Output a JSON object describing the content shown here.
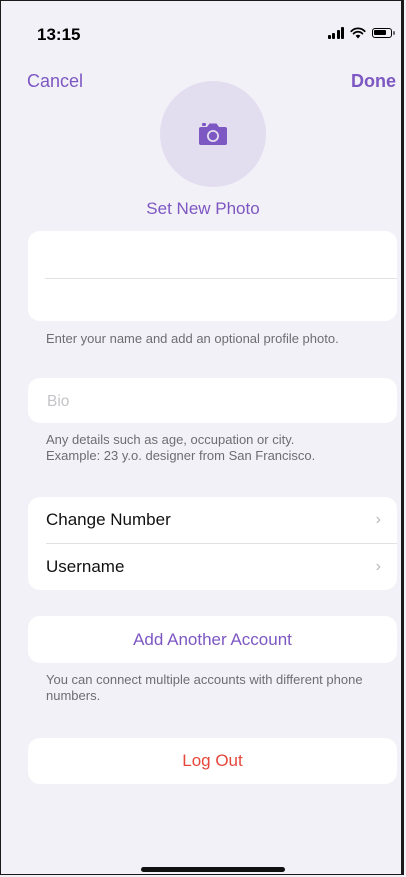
{
  "status_bar": {
    "time": "13:15"
  },
  "nav": {
    "cancel_label": "Cancel",
    "done_label": "Done"
  },
  "profile": {
    "set_photo_label": "Set New Photo"
  },
  "name": {
    "first_value": "",
    "last_value": "",
    "hint": "Enter your name and add an optional profile photo."
  },
  "bio": {
    "placeholder": "Bio",
    "hint_line1": "Any details such as age, occupation or city.",
    "hint_line2": "Example: 23 y.o. designer from San Francisco."
  },
  "settings": {
    "items": [
      {
        "label": "Change Number"
      },
      {
        "label": "Username"
      }
    ]
  },
  "accounts": {
    "add_label": "Add Another Account",
    "hint": "You can connect multiple accounts with different phone numbers."
  },
  "logout": {
    "label": "Log Out"
  },
  "colors": {
    "accent": "#7d57c2",
    "destructive": "#e5473c",
    "background": "#f2f1f7"
  },
  "icons": {
    "chevron": "›",
    "camera": "camera-icon"
  }
}
